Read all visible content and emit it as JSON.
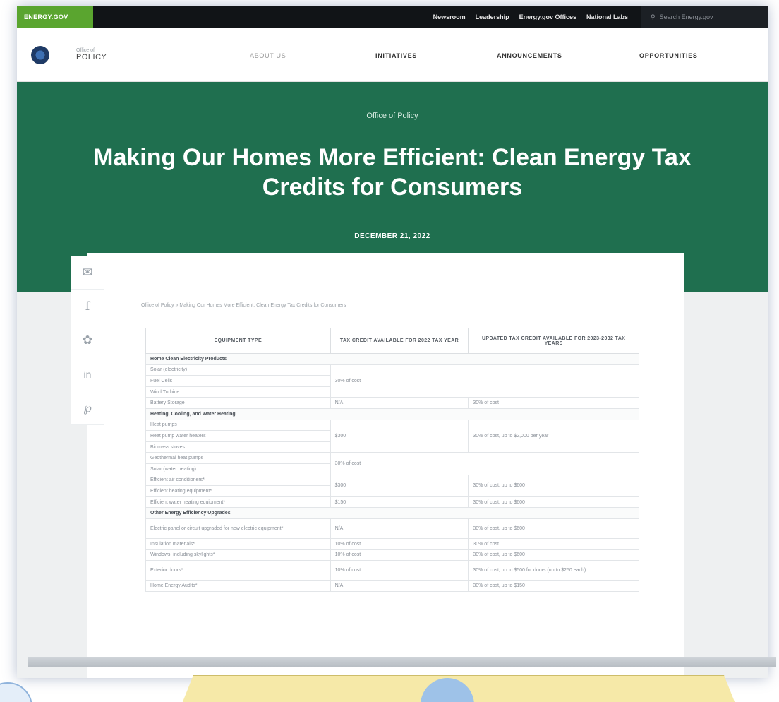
{
  "utility_bar": {
    "brand": "ENERGY.GOV",
    "links": [
      "Newsroom",
      "Leadership",
      "Energy.gov Offices",
      "National Labs"
    ],
    "search_placeholder": "Search Energy.gov"
  },
  "nav": {
    "office_small": "Office of",
    "office_big": "POLICY",
    "items": [
      "ABOUT US",
      "INITIATIVES",
      "ANNOUNCEMENTS",
      "OPPORTUNITIES"
    ]
  },
  "hero": {
    "eyebrow": "Office of Policy",
    "title": "Making Our Homes More Efficient: Clean Energy Tax Credits for Consumers",
    "date": "DECEMBER 21, 2022"
  },
  "breadcrumb": "Office of Policy » Making Our Homes More Efficient: Clean Energy Tax Credits for Consumers",
  "table": {
    "headers": [
      "EQUIPMENT TYPE",
      "TAX CREDIT AVAILABLE FOR 2022 TAX YEAR",
      "UPDATED TAX CREDIT AVAILABLE FOR 2023-2032 TAX YEARS"
    ],
    "sections": {
      "s1": "Home Clean Electricity Products",
      "s2": "Heating, Cooling, and Water Heating",
      "s3": "Other Energy Efficiency Upgrades"
    },
    "rows": {
      "solar": "Solar (electricity)",
      "fuel": "Fuel Cells",
      "wind": "Wind Turbine",
      "battery": "Battery Storage",
      "heatpumps": "Heat pumps",
      "hpwater": "Heat pump water heaters",
      "biomass": "Biomass stoves",
      "geo": "Geothermal heat pumps",
      "solarwater": "Solar (water heating)",
      "ac": "Efficient air conditioners*",
      "heating": "Efficient heating equipment*",
      "waterheat": "Efficient water heating equipment*",
      "panel": "Electric panel or circuit upgraded for new electric equipment*",
      "insulation": "Insulation materials*",
      "windows": "Windows, including skylights*",
      "doors": "Exterior doors*",
      "audits": "Home Energy Audits*"
    },
    "values": {
      "c30": "30% of cost",
      "na": "N/A",
      "c30b": "30% of cost",
      "d300": "$300",
      "hp_new": "30% of cost, up to $2,000 per year",
      "c30c": "30% of cost",
      "d300b": "$300",
      "ac_new": "30% of cost, up to $600",
      "d150": "$150",
      "wh_new": "30% of cost, up to $600",
      "na2": "N/A",
      "panel_new": "30% of cost, up to $600",
      "c10": "10% of cost",
      "c30d": "30% of cost",
      "c10b": "10% of cost",
      "win_new": "30% of cost, up to $600",
      "c10c": "10% of cost",
      "door_new": "30% of cost, up to $500 for doors (up to $250 each)",
      "na3": "N/A",
      "audit_new": "30% of cost, up to $150"
    }
  }
}
